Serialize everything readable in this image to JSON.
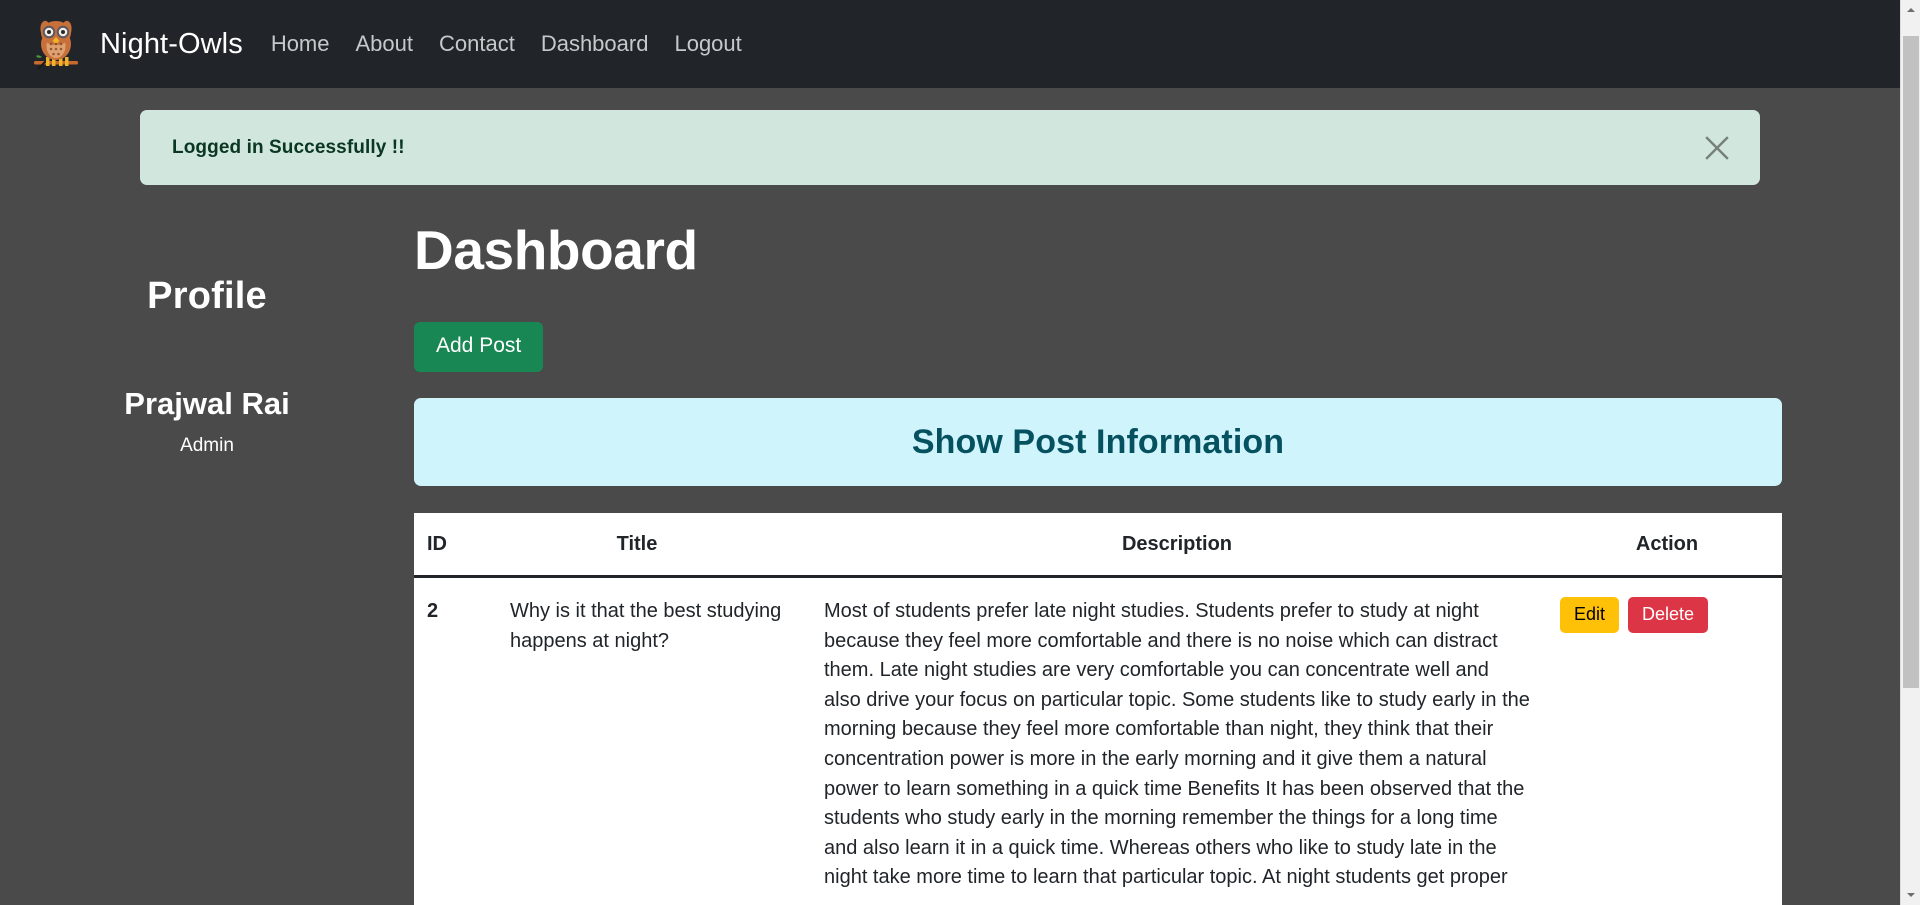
{
  "navbar": {
    "logo_icon": "owl-logo-icon",
    "brand": "Night-Owls",
    "links": [
      {
        "label": "Home"
      },
      {
        "label": "About"
      },
      {
        "label": "Contact"
      },
      {
        "label": "Dashboard"
      },
      {
        "label": "Logout"
      }
    ],
    "bg_color": "#212529"
  },
  "alert": {
    "message": "Logged in Successfully !!",
    "close_icon": "close-icon",
    "bg_color": "#d1e7dd",
    "text_color": "#0a3622"
  },
  "sidebar": {
    "title": "Profile",
    "user_name": "Prajwal Rai",
    "user_role": "Admin"
  },
  "main": {
    "page_title": "Dashboard",
    "add_post_label": "Add Post",
    "add_post_color": "#198754",
    "panel_heading": "Show Post Information",
    "panel_bg_color": "#cff4fc",
    "panel_text_color": "#055160"
  },
  "table": {
    "columns": [
      "ID",
      "Title",
      "Description",
      "Action"
    ],
    "rows": [
      {
        "id": "2",
        "title": "Why is it that the best studying happens at night?",
        "description": "Most of students prefer late night studies. Students prefer to study at night because they feel more comfortable and there is no noise which can distract them. Late night studies are very comfortable you can concentrate well and also drive your focus on particular topic. Some students like to study early in the morning because they feel more comfortable than night, they think that their concentration power is more in the early morning and it give them a natural power to learn something in a quick time Benefits It has been observed that the students who study early in the morning remember the things for a long time and also learn it in a quick time. Whereas others who like to study late in the night take more time to learn that particular topic. At night students get proper",
        "edit_label": "Edit",
        "delete_label": "Delete",
        "edit_color": "#ffc107",
        "delete_color": "#dc3545"
      }
    ]
  },
  "scrollbar": {
    "up_arrow_icon": "scroll-up-arrow-icon",
    "down_arrow_icon": "scroll-down-arrow-icon"
  }
}
